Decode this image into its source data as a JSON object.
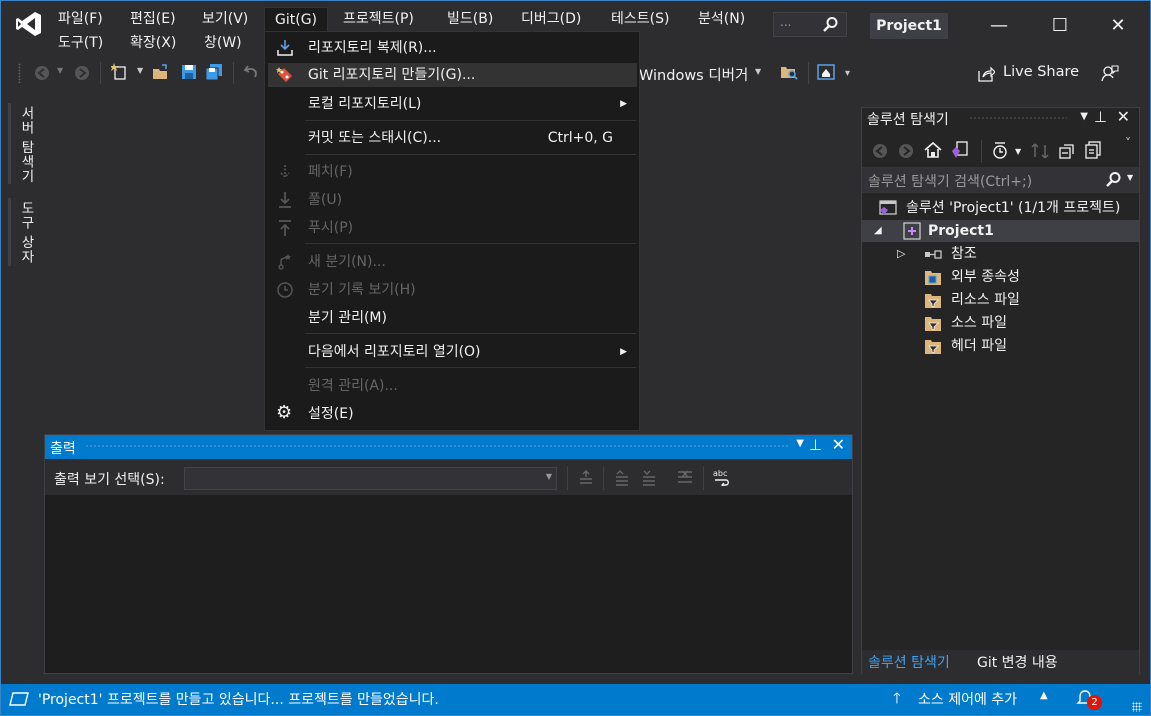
{
  "menubar": {
    "row1": [
      "파일(F)",
      "편집(E)",
      "보기(V)",
      "Git(G)",
      "프로젝트(P)",
      "빌드(B)",
      "디버그(D)",
      "테스트(S)",
      "분석(N)"
    ],
    "row2": [
      "도구(T)",
      "확장(X)",
      "창(W)"
    ],
    "search_placeholder": "...",
    "project_title": "Project1"
  },
  "window_controls": {
    "minimize": "—",
    "maximize": "☐",
    "close": "✕"
  },
  "toolbar": {
    "debugger_label": "Windows 디버거",
    "live_share": "Live Share"
  },
  "left_tabs": [
    "서버 탐색기",
    "도구 상자"
  ],
  "git_menu": {
    "items": [
      {
        "label": "리포지토리 복제(R)...",
        "icon": "clone-icon",
        "state": "normal"
      },
      {
        "label": "Git 리포지토리 만들기(G)...",
        "icon": "create-repo-icon",
        "state": "hover"
      },
      {
        "label": "로컬 리포지토리(L)",
        "submenu": true,
        "state": "normal"
      },
      {
        "label": "커밋 또는 스태시(C)...",
        "shortcut": "Ctrl+0, G",
        "state": "normal"
      },
      {
        "label": "페치(F)",
        "icon": "fetch-icon",
        "state": "disabled"
      },
      {
        "label": "풀(U)",
        "icon": "pull-icon",
        "state": "disabled"
      },
      {
        "label": "푸시(P)",
        "icon": "push-icon",
        "state": "disabled"
      },
      {
        "label": "새 분기(N)...",
        "icon": "new-branch-icon",
        "state": "disabled"
      },
      {
        "label": "분기 기록 보기(H)",
        "icon": "history-icon",
        "state": "disabled"
      },
      {
        "label": "분기 관리(M)",
        "state": "normal"
      },
      {
        "label": "다음에서 리포지토리 열기(O)",
        "submenu": true,
        "state": "normal"
      },
      {
        "label": "원격 관리(A)...",
        "state": "disabled"
      },
      {
        "label": "설정(E)",
        "icon": "gear-icon",
        "state": "normal"
      }
    ]
  },
  "output": {
    "title": "출력",
    "show_label": "출력 보기 선택(S):",
    "selected_source": ""
  },
  "solution_explorer": {
    "title": "솔루션 탐색기",
    "search_placeholder": "솔루션 탐색기 검색(Ctrl+;)",
    "tree": [
      {
        "label": "솔루션 'Project1' (1/1개 프로젝트)",
        "icon": "solution-icon"
      },
      {
        "label": "Project1",
        "icon": "project-icon",
        "expanded": true,
        "selected": true
      },
      {
        "label": "참조",
        "icon": "references-icon",
        "collapsed": true
      },
      {
        "label": "외부 종속성",
        "icon": "external-deps-icon"
      },
      {
        "label": "리소스 파일",
        "icon": "filter-folder-icon"
      },
      {
        "label": "소스 파일",
        "icon": "filter-folder-icon"
      },
      {
        "label": "헤더 파일",
        "icon": "filter-folder-icon"
      }
    ],
    "tabs": [
      "솔루션 탐색기",
      "Git 변경 내용"
    ]
  },
  "status_bar": {
    "message": "'Project1' 프로젝트를 만들고 있습니다... 프로젝트를 만들었습니다.",
    "source_control": "소스 제어에 추가",
    "notifications": "2"
  },
  "colors": {
    "accent": "#007acc",
    "background": "#2d2d30",
    "menu_bg": "#1b1b1c",
    "vs_purple": "#c586ff"
  }
}
